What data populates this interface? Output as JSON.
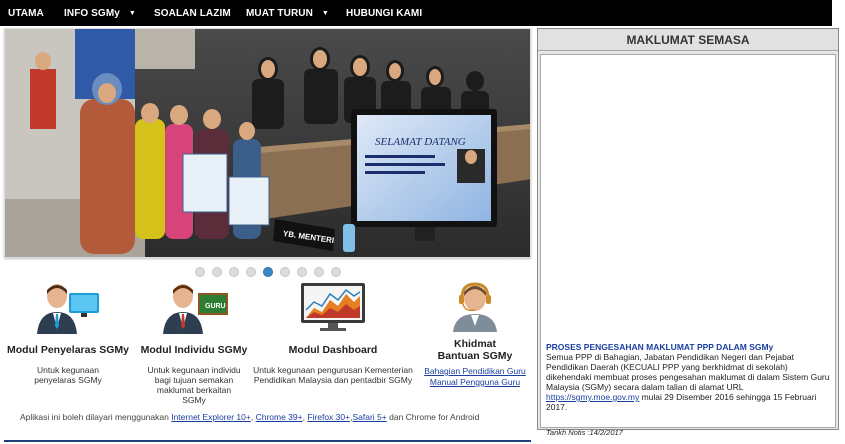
{
  "nav": {
    "items": [
      {
        "label": "UTAMA",
        "dropdown": false
      },
      {
        "label": "INFO SGMy",
        "dropdown": true
      },
      {
        "label": "SOALAN LAZIM",
        "dropdown": false
      },
      {
        "label": "MUAT TURUN",
        "dropdown": true
      },
      {
        "label": "HUBUNGI KAMI",
        "dropdown": false
      }
    ]
  },
  "slider": {
    "dots_count": 9,
    "active_dot": 4,
    "photo_text": {
      "screen_greeting": "SELAMAT DATANG",
      "nameplate": "YB. MENTERI"
    }
  },
  "modules": {
    "penyelaras": {
      "title": "Modul Penyelaras SGMy",
      "desc": "Untuk kegunaan penyelaras SGMy"
    },
    "individu": {
      "title": "Modul Individu SGMy",
      "desc": "Untuk kegunaan individu bagi tujuan semakan maklumat berkaitan SGMy",
      "board_label": "GURU"
    },
    "dashboard": {
      "title": "Modul Dashboard",
      "desc": "Untuk kegunaan pengurusan Kementerian Pendidikan Malaysia dan pentadbir SGMy"
    },
    "khidmat": {
      "title": "Khidmat Bantuan SGMy",
      "link1": "Bahagian Pendidikan Guru",
      "link2": "Manual Pengguna Guru"
    }
  },
  "footer": {
    "prefix": "Aplikasi ini boleh dilayari menggunakan",
    "ie": "Internet Explorer 10+",
    "chrome": "Chrome 39+",
    "firefox": "Firefox 30+",
    "safari": "Safari 5+",
    "suffix": "dan Chrome for Android"
  },
  "panel": {
    "title": "MAKLUMAT SEMASA",
    "news_title": "PROSES PENGESAHAN MAKLUMAT PPP DALAM SGMy",
    "news_body_1": "Semua PPP di Bahagian, Jabatan Pendidikan Negeri dan Pejabat Pendidikan Daerah (KECUALI PPP yang berkhidmat di sekolah) dikehendaki membuat proses pengesahan maklumat di dalam Sistem Guru Malaysia (SGMy) secara dalam talian di alamat URL",
    "news_link": "https://sgmy.moe.gov.my",
    "news_body_2": "mulai 29 Disember 2016 sehingga 15 Februari 2017.",
    "news_date": "Tarikh Notis :14/2/2017"
  },
  "colors": {
    "nav_bg": "#000000",
    "link": "#1a3fa0",
    "active_dot": "#3b87c4",
    "bottom_line": "#1e3f7a"
  }
}
